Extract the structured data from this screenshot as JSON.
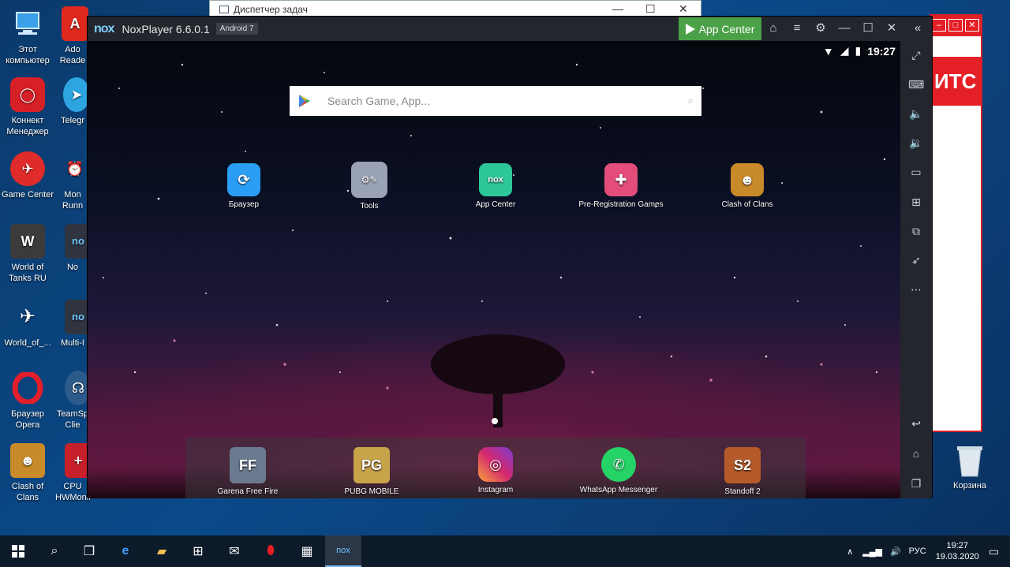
{
  "desktop": {
    "icons_left": [
      {
        "label": "Этот компьютер",
        "icon": "computer-icon"
      },
      {
        "label": "Коннект Менеджер",
        "icon": "connect-manager-icon"
      },
      {
        "label": "Game Center",
        "icon": "game-center-icon"
      },
      {
        "label": "World of Tanks RU",
        "icon": "world-of-tanks-icon"
      },
      {
        "label": "World_of_...",
        "icon": "world-of-warplanes-icon"
      },
      {
        "label": "Браузер Opera",
        "icon": "opera-icon"
      },
      {
        "label": "Clash of Clans",
        "icon": "clash-of-clans-icon"
      }
    ],
    "icons_col2": [
      {
        "label": "Ado Reade",
        "icon": "adobe-reader-icon"
      },
      {
        "label": "Telegr",
        "icon": "telegram-icon"
      },
      {
        "label": "Mon Runn",
        "icon": "monitor-runner-icon"
      },
      {
        "label": "No",
        "icon": "nox-icon"
      },
      {
        "label": "Multi-I",
        "icon": "multi-instance-icon"
      },
      {
        "label": "TeamSp Clie",
        "icon": "teamspeak-icon"
      },
      {
        "label": "CPU HWMonit...",
        "icon": "hwmonitor-icon"
      }
    ],
    "recycle_bin": "Корзина"
  },
  "task_manager": {
    "title": "Диспетчер задач"
  },
  "mts_window": {
    "brand": "ИТС"
  },
  "nox": {
    "logo": "nox",
    "title": "NoxPlayer 6.6.0.1",
    "android_version": "Android 7",
    "app_center_label": "App Center",
    "status_time": "19:27",
    "search_placeholder": "Search Game, App...",
    "apps": [
      {
        "label": "Браузер",
        "icon": "browser-icon",
        "color": "#2a9df4"
      },
      {
        "label": "Tools",
        "icon": "tools-folder-icon",
        "color": "#9aa3b5"
      },
      {
        "label": "App Center",
        "icon": "app-center-icon",
        "color": "#2ec79a"
      },
      {
        "label": "Pre-Registration Games",
        "icon": "gamepad-icon",
        "color": "#e24d7a"
      },
      {
        "label": "Clash of Clans",
        "icon": "clash-of-clans-icon",
        "color": "#c98a2a"
      }
    ],
    "dock": [
      {
        "label": "Garena Free Fire",
        "icon": "free-fire-icon",
        "color": "#6b7a90"
      },
      {
        "label": "PUBG MOBILE",
        "icon": "pubg-icon",
        "color": "#c7a34a"
      },
      {
        "label": "Instagram",
        "icon": "instagram-icon",
        "color": "#d6296f"
      },
      {
        "label": "WhatsApp Messenger",
        "icon": "whatsapp-icon",
        "color": "#25d366"
      },
      {
        "label": "Standoff 2",
        "icon": "standoff-icon",
        "color": "#b55b2a"
      }
    ]
  },
  "taskbar": {
    "language": "РУС",
    "time": "19:27",
    "date": "19.03.2020"
  }
}
